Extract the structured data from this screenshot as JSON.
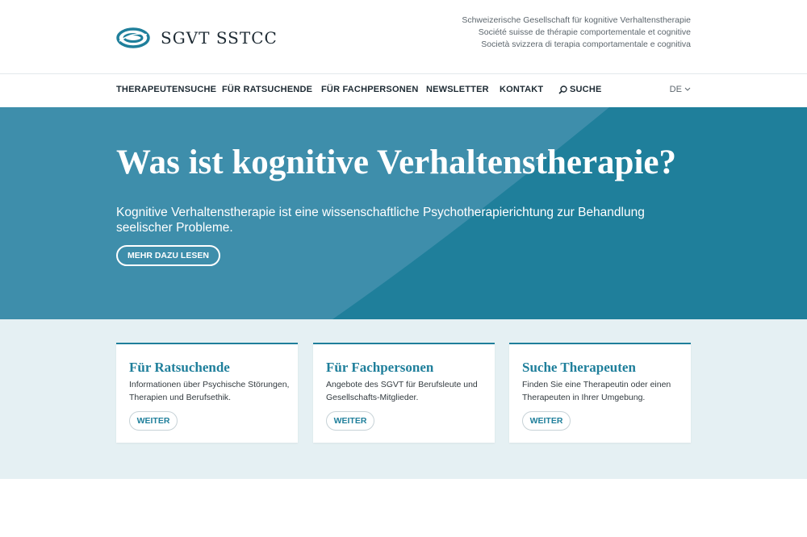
{
  "header": {
    "logo_text": "SGVT SSTCC",
    "society_lines": [
      "Schweizerische Gesellschaft für kognitive Verhaltenstherapie",
      "Société suisse de thérapie comportementale et cognitive",
      "Società svizzera di terapia comportamentale e cognitiva"
    ]
  },
  "nav": {
    "items": [
      {
        "label": "THERAPEUTENSUCHE"
      },
      {
        "label": "FÜR RATSUCHENDE"
      },
      {
        "label": "FÜR FACHPERSONEN"
      },
      {
        "label": "NEWSLETTER"
      },
      {
        "label": "KONTAKT"
      },
      {
        "label": "SUCHE",
        "icon": "search-icon"
      }
    ],
    "language": "DE",
    "language_icon": "chevron-down-icon"
  },
  "hero": {
    "title": "Was ist kognitive Verhaltenstherapie?",
    "text": "Kognitive Verhaltenstherapie ist eine wissenschaftliche Psychotherapierichtung zur Behandlung seelischer Probleme.",
    "button": "MEHR DAZU LESEN"
  },
  "cards": [
    {
      "title": "Für Ratsuchende",
      "text": "Informationen über Psychische Störungen, Therapien und Berufsethik.",
      "button": "WEITER"
    },
    {
      "title": "Für Fachpersonen",
      "text": "Angebote des SGVT für Berufsleute und Gesellschafts-Mitglieder.",
      "button": "WEITER"
    },
    {
      "title": "Suche Therapeuten",
      "text": "Finden Sie eine Therapeutin oder einen Therapeuten in Ihrer Umgebung.",
      "button": "WEITER"
    }
  ],
  "colors": {
    "brand": "#1f7f9b",
    "hero_light": "#3e8eab",
    "cards_background": "#e5f0f3"
  }
}
